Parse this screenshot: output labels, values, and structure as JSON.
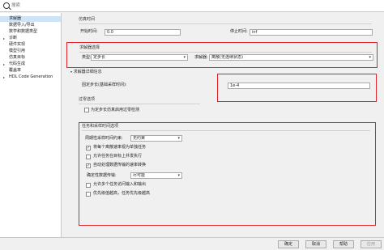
{
  "search": {
    "placeholder": "搜索"
  },
  "tree": [
    {
      "label": "求解器",
      "selected": true,
      "arrow": ""
    },
    {
      "label": "数据导入/导出",
      "selected": false,
      "arrow": ""
    },
    {
      "label": "数学和数据类型",
      "selected": false,
      "arrow": ""
    },
    {
      "label": "诊断",
      "selected": false,
      "arrow": "▸"
    },
    {
      "label": "硬件实现",
      "selected": false,
      "arrow": ""
    },
    {
      "label": "模型引用",
      "selected": false,
      "arrow": ""
    },
    {
      "label": "仿真目标",
      "selected": false,
      "arrow": ""
    },
    {
      "label": "代码生成",
      "selected": false,
      "arrow": "▸"
    },
    {
      "label": "覆盖率",
      "selected": false,
      "arrow": ""
    },
    {
      "label": "HDL Code Generation",
      "selected": false,
      "arrow": "▸"
    }
  ],
  "sim_time": {
    "title": "仿真时间",
    "start_label": "开始时间:",
    "start_value": "0.0",
    "stop_label": "停止时间:",
    "stop_value": "inf"
  },
  "solver_select": {
    "title": "求解器选择",
    "type_label": "类型:",
    "type_value": "定步长",
    "solver_label": "求解器:",
    "solver_value": "离散(无连续状态)"
  },
  "solver_details": {
    "title": "求解器详细信息",
    "step_label": "固定步长(基础采样时间):",
    "step_value": "1e-4"
  },
  "zero_cross": {
    "title": "过零选项",
    "checkbox_label": "为定步长仿真启用过零检测"
  },
  "tasks": {
    "title": "任务和采样时间选项",
    "periodic_label": "周期性采样时间约束:",
    "periodic_value": "无约束",
    "cb1_label": "将每个离散速率视为单独任务",
    "cb2_label": "允许任务在目标上并发执行",
    "cb3_label": "自动处理数据传输的速率转换",
    "det_label": "确定性数据传输:",
    "det_value": "尽可能",
    "cb4_label": "允许多个任务访问输入和输出",
    "cb5_label": "优先级值越高，任务优先级越高",
    "cb1_checked": true,
    "cb2_checked": false,
    "cb3_checked": true,
    "cb4_checked": false,
    "cb5_checked": false
  },
  "footer": {
    "ok": "确定",
    "cancel": "取消",
    "help": "帮助",
    "apply": "应用"
  },
  "colors": {
    "highlight": "#e0222b",
    "selected": "#cfe3f7"
  },
  "icons": {
    "search": "search-icon",
    "expand": "chevron-right-icon",
    "collapse": "chevron-down-icon"
  }
}
